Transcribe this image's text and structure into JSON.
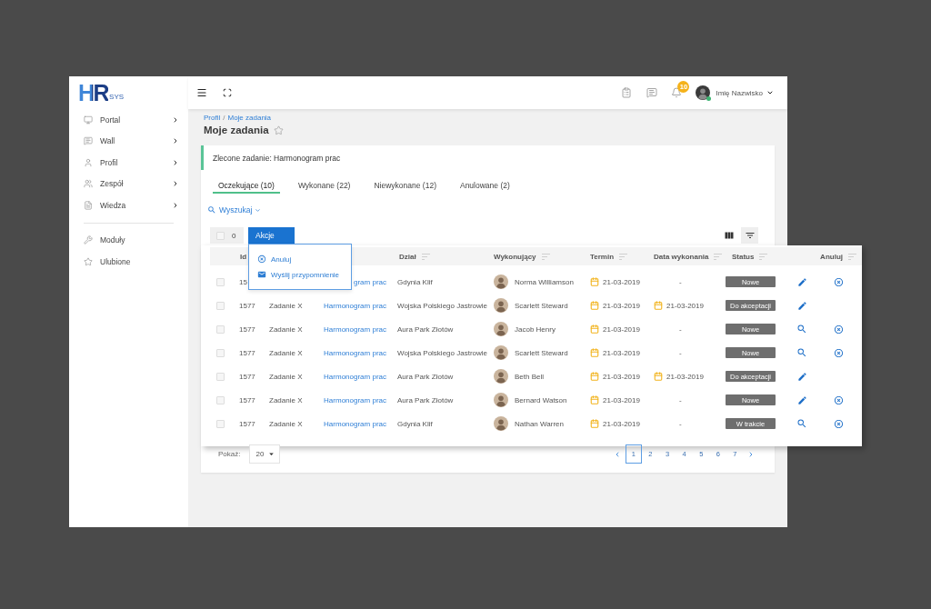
{
  "logo": {
    "mark": "HR",
    "suffix": "SYS"
  },
  "topbar": {
    "notifications": "10",
    "user": {
      "name": "Imię Nazwisko",
      "online": true
    }
  },
  "sidebar": {
    "groups": [
      {
        "items": [
          {
            "label": "Portal",
            "expandable": true
          },
          {
            "label": "Wall",
            "expandable": true
          },
          {
            "label": "Profil",
            "expandable": true
          },
          {
            "label": "Zespół",
            "expandable": true
          },
          {
            "label": "Wiedza",
            "expandable": true
          }
        ]
      },
      {
        "items": [
          {
            "label": "Moduły",
            "expandable": false
          },
          {
            "label": "Ulubione",
            "expandable": false
          }
        ]
      }
    ]
  },
  "breadcrumb": {
    "items": [
      "Profil",
      "Moje zadania"
    ],
    "separator": "/"
  },
  "page": {
    "title": "Moje zadania",
    "favorite": false
  },
  "assignment": "Zlecone zadanie: Harmonogram prac",
  "tabs": [
    {
      "label": "Oczekujące (10)",
      "selected": true
    },
    {
      "label": "Wykonane (22)",
      "selected": false
    },
    {
      "label": "Niewykonane (12)",
      "selected": false
    },
    {
      "label": "Anulowane (2)",
      "selected": false
    }
  ],
  "search": {
    "label": "Wyszukaj"
  },
  "toolbar": {
    "select_all": {
      "checked": false
    },
    "selected_count": "0",
    "actions": {
      "label": "Akcje",
      "expanded": true,
      "items": [
        {
          "label": "Anuluj",
          "kind": "cancel"
        },
        {
          "label": "Wyślij przypomnienie",
          "kind": "remind"
        }
      ]
    }
  },
  "table": {
    "columns": [
      {
        "kind": "id",
        "label": "Id",
        "sortable": false
      },
      {
        "kind": "department",
        "label": "Dział",
        "sortable": true
      },
      {
        "kind": "performer",
        "label": "Wykonujący",
        "sortable": true
      },
      {
        "kind": "due",
        "label": "Termin",
        "sortable": true
      },
      {
        "kind": "done",
        "label": "Data wykonania",
        "sortable": true
      },
      {
        "kind": "status",
        "label": "Status",
        "sortable": true
      },
      {
        "kind": "cancel",
        "label": "Anuluj",
        "sortable": true
      }
    ],
    "rows": [
      {
        "checked": false,
        "id": "15",
        "task": "gram prac",
        "department": "Gdynia Klif",
        "performer": "Norma Williamson",
        "due": "21-03-2019",
        "done": {
          "kind": "empty",
          "text": "-"
        },
        "status": "Nowe",
        "action": {
          "kind": "edit"
        },
        "cancellable": true
      },
      {
        "checked": false,
        "id": "1577",
        "name": "Zadanie X",
        "task": "Harmonogram prac",
        "department": "Wojska Polskiego Jastrowie",
        "performer": "Scarlett Steward",
        "due": "21-03-2019",
        "done": {
          "kind": "date",
          "text": "21-03-2019"
        },
        "status": "Do akceptacji",
        "action": {
          "kind": "edit"
        },
        "cancellable": false
      },
      {
        "checked": false,
        "id": "1577",
        "name": "Zadanie X",
        "task": "Harmonogram prac",
        "department": "Aura Park Złotów",
        "performer": "Jacob Henry",
        "due": "21-03-2019",
        "done": {
          "kind": "empty",
          "text": "-"
        },
        "status": "Nowe",
        "action": {
          "kind": "view"
        },
        "cancellable": true
      },
      {
        "checked": false,
        "id": "1577",
        "name": "Zadanie X",
        "task": "Harmonogram prac",
        "department": "Wojska Polskiego Jastrowie",
        "performer": "Scarlett Steward",
        "due": "21-03-2019",
        "done": {
          "kind": "empty",
          "text": "-"
        },
        "status": "Nowe",
        "action": {
          "kind": "view"
        },
        "cancellable": true
      },
      {
        "checked": false,
        "id": "1577",
        "name": "Zadanie X",
        "task": "Harmonogram prac",
        "department": "Aura Park Złotów",
        "performer": "Beth Bell",
        "due": "21-03-2019",
        "done": {
          "kind": "date",
          "text": "21-03-2019"
        },
        "status": "Do akceptacji",
        "action": {
          "kind": "edit"
        },
        "cancellable": false
      },
      {
        "checked": false,
        "id": "1577",
        "name": "Zadanie X",
        "task": "Harmonogram prac",
        "department": "Aura Park Złotów",
        "performer": "Bernard Watson",
        "due": "21-03-2019",
        "done": {
          "kind": "empty",
          "text": "-"
        },
        "status": "Nowe",
        "action": {
          "kind": "edit"
        },
        "cancellable": true
      },
      {
        "checked": false,
        "id": "1577",
        "name": "Zadanie X",
        "task": "Harmonogram prac",
        "department": "Gdynia Klif",
        "performer": "Nathan Warren",
        "due": "21-03-2019",
        "done": {
          "kind": "empty",
          "text": "-"
        },
        "status": "W trakcie",
        "action": {
          "kind": "view"
        },
        "cancellable": true
      }
    ]
  },
  "footer": {
    "page_size_label": "Pokaż:",
    "page_size": "20",
    "pages": [
      {
        "label": "1",
        "selected": true
      },
      {
        "label": "2",
        "selected": false
      },
      {
        "label": "3",
        "selected": false
      },
      {
        "label": "4",
        "selected": false
      },
      {
        "label": "5",
        "selected": false
      },
      {
        "label": "6",
        "selected": false
      },
      {
        "label": "7",
        "selected": false
      }
    ]
  }
}
